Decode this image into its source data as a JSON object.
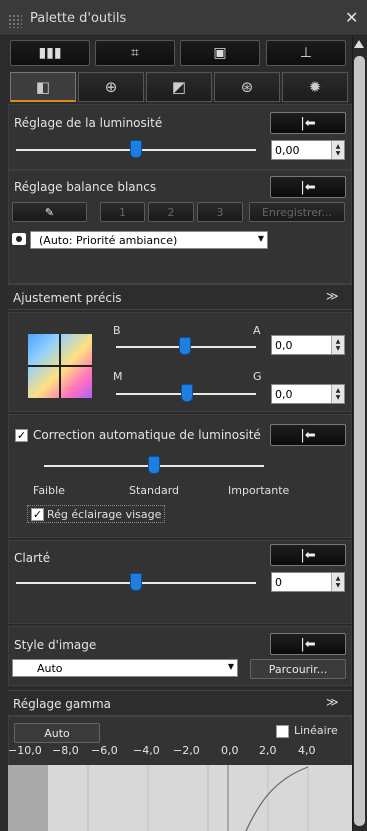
{
  "window": {
    "title": "Palette d'outils",
    "close_icon": "close-icon"
  },
  "toolbar": {
    "buttons": [
      {
        "icon": "film-strip-icon",
        "glyph": "▮▮▮"
      },
      {
        "icon": "crop-icon",
        "glyph": "⌗"
      },
      {
        "icon": "image-frame-icon",
        "glyph": "▣"
      },
      {
        "icon": "stamp-icon",
        "glyph": "⊥"
      }
    ]
  },
  "tabs": [
    {
      "icon": "basic-adjust-icon",
      "glyph": "◧",
      "active": true
    },
    {
      "icon": "detail-zoom-icon",
      "glyph": "⊕"
    },
    {
      "icon": "tone-curve-icon",
      "glyph": "◩"
    },
    {
      "icon": "color-wheel-icon",
      "glyph": "⊛"
    },
    {
      "icon": "settings-gear-icon",
      "glyph": "✹"
    }
  ],
  "brightness": {
    "label": "Réglage de la luminosité",
    "value": "0,00",
    "reset_glyph": "|⬅"
  },
  "white_balance": {
    "label": "Réglage balance blancs",
    "reset_glyph": "|⬅",
    "eyedropper_glyph": "✎",
    "presets": [
      "1",
      "2",
      "3"
    ],
    "register_label": "Enregistrer...",
    "selected": "(Auto: Priorité ambiance)"
  },
  "fine_adjust": {
    "title": "Ajustement précis",
    "b_label": "B",
    "a_label": "A",
    "ba_value": "0,0",
    "m_label": "M",
    "g_label": "G",
    "mg_value": "0,0"
  },
  "auto_lighting": {
    "label": "Correction automatique de luminosité",
    "checked": true,
    "levels": [
      "Faible",
      "Standard",
      "Importante"
    ],
    "face_label": "Rég éclairage visage",
    "face_checked": true
  },
  "clarity": {
    "label": "Clarté",
    "value": "0"
  },
  "picture_style": {
    "label": "Style d'image",
    "selected": "Auto",
    "browse_label": "Parcourir..."
  },
  "gamma": {
    "title": "Réglage gamma",
    "auto_label": "Auto",
    "linear_label": "Linéaire",
    "ticks": [
      "−10,0",
      "−8,0",
      "−6,0",
      "−4,0",
      "−2,0",
      "0,0",
      "2,0",
      "4,0"
    ]
  }
}
